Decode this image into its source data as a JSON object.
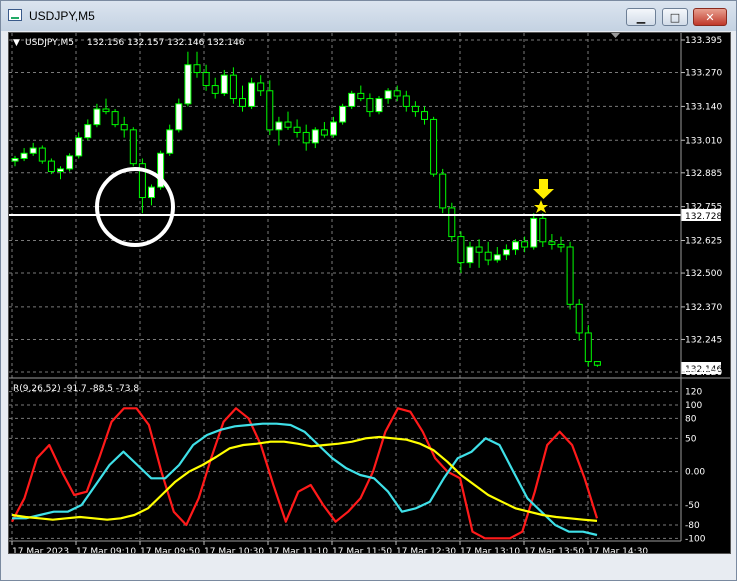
{
  "window": {
    "title": "USDJPY,M5",
    "minimize_glyph": "▁",
    "maximize_glyph": "□",
    "close_glyph": "✕"
  },
  "chart_header": {
    "menu_glyph": "▼",
    "symbol": "USDJPY,M5",
    "ohlc": "132.156 132.157 132.146 132.146"
  },
  "chart_data": [
    {
      "type": "candlestick",
      "title": "USDJPY,M5",
      "ylim": [
        132.12,
        133.395
      ],
      "y_ticks": [
        "133.395",
        "133.270",
        "133.140",
        "133.010",
        "132.885",
        "132.755",
        "132.625",
        "132.500",
        "132.370",
        "132.245",
        "132.120"
      ],
      "current_price": "132.146",
      "horizontal_line": "132.728",
      "candles_ohlc": [
        [
          132.93,
          132.95,
          132.91,
          132.94
        ],
        [
          132.94,
          132.98,
          132.93,
          132.96
        ],
        [
          132.96,
          133.0,
          132.95,
          132.98
        ],
        [
          132.98,
          132.99,
          132.92,
          132.93
        ],
        [
          132.93,
          132.94,
          132.88,
          132.89
        ],
        [
          132.89,
          132.91,
          132.86,
          132.9
        ],
        [
          132.9,
          132.96,
          132.89,
          132.95
        ],
        [
          132.95,
          133.04,
          132.94,
          133.02
        ],
        [
          133.02,
          133.09,
          133.01,
          133.07
        ],
        [
          133.07,
          133.15,
          133.06,
          133.13
        ],
        [
          133.13,
          133.17,
          133.11,
          133.12
        ],
        [
          133.12,
          133.13,
          133.06,
          133.07
        ],
        [
          133.07,
          133.1,
          133.02,
          133.05
        ],
        [
          133.05,
          133.06,
          132.91,
          132.92
        ],
        [
          132.92,
          132.94,
          132.73,
          132.79
        ],
        [
          132.79,
          132.84,
          132.76,
          132.83
        ],
        [
          132.83,
          132.97,
          132.82,
          132.96
        ],
        [
          132.96,
          133.07,
          132.95,
          133.05
        ],
        [
          133.05,
          133.17,
          133.04,
          133.15
        ],
        [
          133.15,
          133.35,
          133.14,
          133.3
        ],
        [
          133.3,
          133.35,
          133.25,
          133.27
        ],
        [
          133.27,
          133.3,
          133.2,
          133.22
        ],
        [
          133.22,
          133.25,
          133.17,
          133.19
        ],
        [
          133.19,
          133.28,
          133.18,
          133.26
        ],
        [
          133.26,
          133.29,
          133.15,
          133.17
        ],
        [
          133.17,
          133.22,
          133.12,
          133.14
        ],
        [
          133.14,
          133.25,
          133.13,
          133.23
        ],
        [
          133.23,
          133.26,
          133.18,
          133.2
        ],
        [
          133.2,
          133.24,
          133.03,
          133.05
        ],
        [
          133.05,
          133.1,
          132.99,
          133.08
        ],
        [
          133.08,
          133.12,
          133.05,
          133.06
        ],
        [
          133.06,
          133.09,
          133.02,
          133.04
        ],
        [
          133.04,
          133.07,
          132.97,
          133.0
        ],
        [
          133.0,
          133.06,
          132.98,
          133.05
        ],
        [
          133.05,
          133.08,
          133.02,
          133.03
        ],
        [
          133.03,
          133.1,
          133.02,
          133.08
        ],
        [
          133.08,
          133.15,
          133.07,
          133.14
        ],
        [
          133.14,
          133.2,
          133.13,
          133.19
        ],
        [
          133.19,
          133.22,
          133.16,
          133.17
        ],
        [
          133.17,
          133.19,
          133.1,
          133.12
        ],
        [
          133.12,
          133.18,
          133.11,
          133.17
        ],
        [
          133.17,
          133.21,
          133.15,
          133.2
        ],
        [
          133.2,
          133.22,
          133.16,
          133.18
        ],
        [
          133.18,
          133.2,
          133.12,
          133.14
        ],
        [
          133.14,
          133.16,
          133.1,
          133.12
        ],
        [
          133.12,
          133.14,
          133.07,
          133.09
        ],
        [
          133.09,
          133.1,
          132.87,
          132.88
        ],
        [
          132.88,
          132.9,
          132.73,
          132.75
        ],
        [
          132.75,
          132.77,
          132.62,
          132.64
        ],
        [
          132.64,
          132.66,
          132.5,
          132.54
        ],
        [
          132.54,
          132.62,
          132.52,
          132.6
        ],
        [
          132.6,
          132.63,
          132.52,
          132.58
        ],
        [
          132.58,
          132.62,
          132.53,
          132.55
        ],
        [
          132.55,
          132.6,
          132.54,
          132.57
        ],
        [
          132.57,
          132.61,
          132.55,
          132.59
        ],
        [
          132.59,
          132.63,
          132.57,
          132.62
        ],
        [
          132.62,
          132.64,
          132.58,
          132.6
        ],
        [
          132.6,
          132.73,
          132.59,
          132.71
        ],
        [
          132.71,
          132.73,
          132.6,
          132.62
        ],
        [
          132.62,
          132.65,
          132.59,
          132.61
        ],
        [
          132.61,
          132.64,
          132.58,
          132.6
        ],
        [
          132.6,
          132.62,
          132.36,
          132.38
        ],
        [
          132.38,
          132.4,
          132.24,
          132.27
        ],
        [
          132.27,
          132.3,
          132.14,
          132.16
        ],
        [
          132.16,
          132.16,
          132.14,
          132.146
        ]
      ]
    },
    {
      "type": "line",
      "title": "R(9,26,52) -91.7 -88.5 -73.8",
      "ylim": [
        -110,
        130
      ],
      "y_ticks": [
        "120",
        "100",
        "80",
        "50",
        "0.00",
        "-50",
        "-80",
        "-100"
      ],
      "series": [
        {
          "values": [
            -75,
            -40,
            20,
            40,
            0,
            -35,
            -30,
            20,
            75,
            95,
            95,
            70,
            0,
            -60,
            -80,
            -40,
            20,
            75,
            95,
            80,
            40,
            -20,
            -75,
            -30,
            -20,
            -50,
            -75,
            -60,
            -40,
            0,
            60,
            95,
            90,
            60,
            20,
            0,
            -10,
            -90,
            -100,
            -100,
            -100,
            -90,
            -30,
            40,
            60,
            40,
            -10,
            -70
          ]
        },
        {
          "values": [
            -70,
            -70,
            -65,
            -60,
            -60,
            -50,
            -20,
            10,
            30,
            10,
            -10,
            -10,
            10,
            40,
            55,
            63,
            68,
            70,
            72,
            72,
            70,
            60,
            40,
            20,
            5,
            -5,
            -10,
            -30,
            -60,
            -55,
            -45,
            -10,
            20,
            30,
            50,
            40,
            0,
            -40,
            -60,
            -80,
            -90,
            -90,
            -95
          ]
        },
        {
          "values": [
            -65,
            -68,
            -70,
            -72,
            -70,
            -68,
            -70,
            -72,
            -70,
            -65,
            -55,
            -35,
            -15,
            0,
            10,
            22,
            35,
            40,
            42,
            45,
            45,
            42,
            38,
            40,
            42,
            45,
            50,
            52,
            50,
            48,
            42,
            32,
            15,
            -5,
            -20,
            -35,
            -45,
            -55,
            -60,
            -65,
            -68,
            -70,
            -72,
            -73.8
          ]
        }
      ]
    }
  ],
  "time_axis": [
    "17 Mar 2023",
    "17 Mar 09:10",
    "17 Mar 09:50",
    "17 Mar 10:30",
    "17 Mar 11:10",
    "17 Mar 11:50",
    "17 Mar 12:30",
    "17 Mar 13:10",
    "17 Mar 13:50",
    "17 Mar 14:30"
  ],
  "colors": {
    "background": "#000000",
    "grid": "#7a7a7a",
    "candle": "#00ff00",
    "bull_body": "#ffffff",
    "bear_body": "#000000",
    "hline": "#ffffff",
    "annotation": "#ffff00",
    "red_line": "#ff1a1a",
    "cyan_line": "#3fe0e8",
    "yellow_line": "#ffff00"
  }
}
